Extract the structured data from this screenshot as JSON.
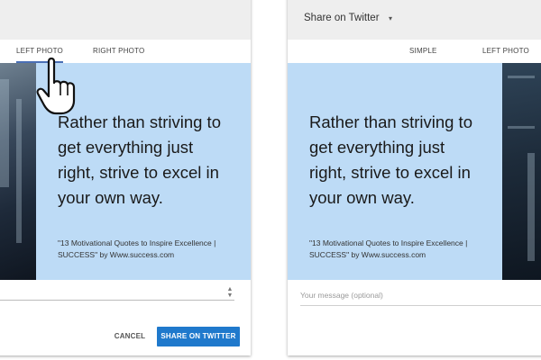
{
  "left_panel": {
    "tabs": [
      {
        "label": "LEFT PHOTO",
        "active": true
      },
      {
        "label": "RIGHT PHOTO",
        "active": false
      }
    ],
    "quote": "Rather than striving to get everything just right, strive to excel in your own way.",
    "source": "\"13 Motivational Quotes to Inspire Excellence | SUCCESS\" by Www.success.com",
    "stepper_up": "▲",
    "stepper_down": "▼",
    "cancel_label": "CANCEL",
    "share_label": "SHARE ON TWITTER"
  },
  "right_panel": {
    "title": "Share on Twitter",
    "title_caret": "▾",
    "tabs": [
      {
        "label": "SIMPLE",
        "active": false
      },
      {
        "label": "LEFT PHOTO",
        "active": false
      }
    ],
    "quote": "Rather than striving to get everything just right, strive to excel in your own way.",
    "source": "\"13 Motivational Quotes to Inspire Excellence | SUCCESS\" by Www.success.com",
    "message_placeholder": "Your message (optional)"
  },
  "icons": {
    "cursor": "pointer-hand-cursor-icon"
  },
  "colors": {
    "card_bg": "#bddbf6",
    "share_button": "#1f79cc",
    "active_tab_underline": "#4a6fb5"
  }
}
